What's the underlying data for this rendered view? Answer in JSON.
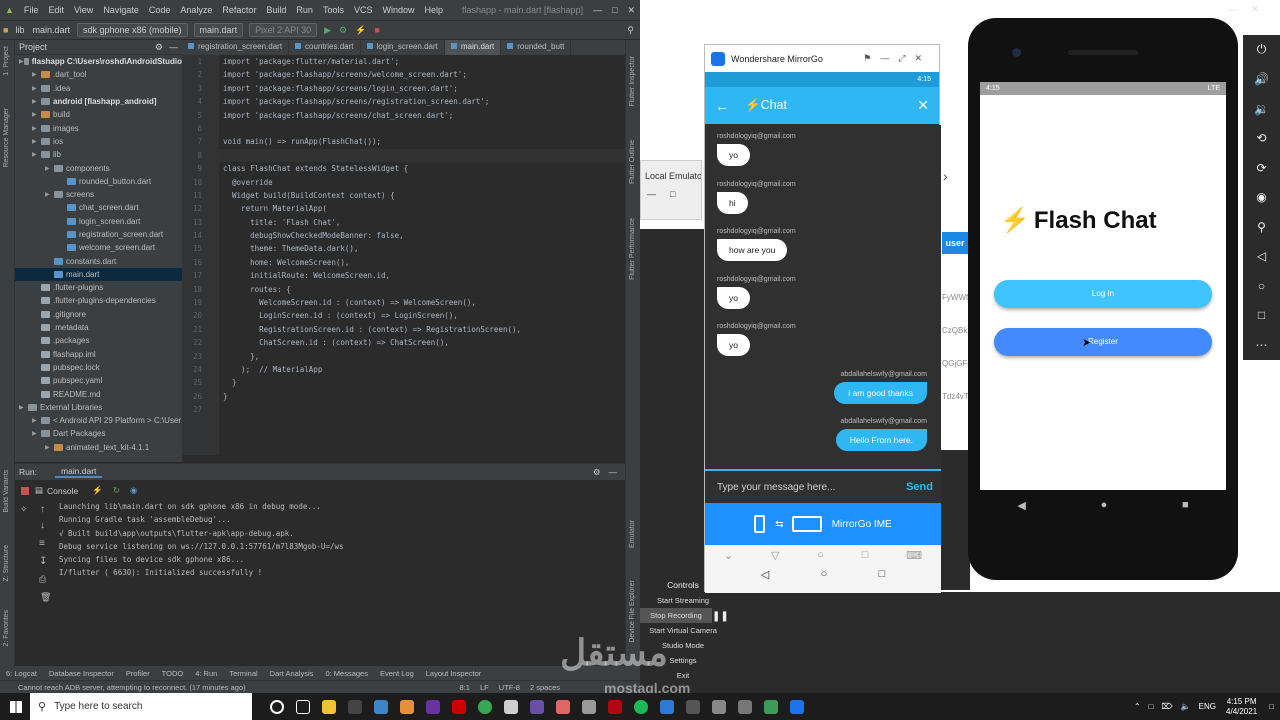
{
  "ide": {
    "menu": [
      "File",
      "Edit",
      "View",
      "Navigate",
      "Code",
      "Analyze",
      "Refactor",
      "Build",
      "Run",
      "Tools",
      "VCS",
      "Window",
      "Help"
    ],
    "window_title": "flashapp - main.dart [flashapp]",
    "toolbar": {
      "crumb_lib": "lib",
      "crumb_file": "main.dart",
      "device": "sdk gphone x86 (mobile)",
      "run_config": "main.dart",
      "avd": "Pixel 2 API 30"
    },
    "project_label": "Project",
    "tree": [
      {
        "label": "flashapp  C:\\Users\\roshd\\AndroidStudio",
        "indent": 0,
        "icon": "fold",
        "bold": true
      },
      {
        "label": ".dart_tool",
        "indent": 1,
        "icon": "fold-o"
      },
      {
        "label": ".idea",
        "indent": 1,
        "icon": "fold"
      },
      {
        "label": "android [flashapp_android]",
        "indent": 1,
        "icon": "fold",
        "bold": true
      },
      {
        "label": "build",
        "indent": 1,
        "icon": "fold-o"
      },
      {
        "label": "images",
        "indent": 1,
        "icon": "fold"
      },
      {
        "label": "ios",
        "indent": 1,
        "icon": "fold"
      },
      {
        "label": "lib",
        "indent": 1,
        "icon": "fold"
      },
      {
        "label": "components",
        "indent": 2,
        "icon": "fold"
      },
      {
        "label": "rounded_button.dart",
        "indent": 3,
        "icon": "fl"
      },
      {
        "label": "screens",
        "indent": 2,
        "icon": "fold"
      },
      {
        "label": "chat_screen.dart",
        "indent": 3,
        "icon": "fl"
      },
      {
        "label": "login_screen.dart",
        "indent": 3,
        "icon": "fl"
      },
      {
        "label": "registration_screen.dart",
        "indent": 3,
        "icon": "fl"
      },
      {
        "label": "welcome_screen.dart",
        "indent": 3,
        "icon": "fl"
      },
      {
        "label": "constants.dart",
        "indent": 2,
        "icon": "fl"
      },
      {
        "label": "main.dart",
        "indent": 2,
        "icon": "fl",
        "sel": true
      },
      {
        "label": ".flutter-plugins",
        "indent": 1,
        "icon": "fy"
      },
      {
        "label": ".flutter-plugins-dependencies",
        "indent": 1,
        "icon": "fy"
      },
      {
        "label": ".gitignore",
        "indent": 1,
        "icon": "fy"
      },
      {
        "label": ".metadata",
        "indent": 1,
        "icon": "fy"
      },
      {
        "label": ".packages",
        "indent": 1,
        "icon": "fy"
      },
      {
        "label": "flashapp.iml",
        "indent": 1,
        "icon": "fy"
      },
      {
        "label": "pubspec.lock",
        "indent": 1,
        "icon": "fy"
      },
      {
        "label": "pubspec.yaml",
        "indent": 1,
        "icon": "fy"
      },
      {
        "label": "README.md",
        "indent": 1,
        "icon": "fy"
      },
      {
        "label": "External Libraries",
        "indent": 0,
        "icon": "fold"
      },
      {
        "label": "< Android API 29 Platform >  C:\\User",
        "indent": 1,
        "icon": "fold"
      },
      {
        "label": "Dart Packages",
        "indent": 1,
        "icon": "fold"
      },
      {
        "label": "animated_text_kit-4.1.1",
        "indent": 2,
        "icon": "fold-o"
      }
    ],
    "tabs": [
      "registration_screen.dart",
      "countries.dart",
      "login_screen.dart",
      "main.dart",
      "rounded_butt"
    ],
    "active_tab": 3,
    "line_numbers": [
      "1",
      "2",
      "3",
      "4",
      "5",
      "6",
      "7",
      "8",
      "9",
      "10",
      "11",
      "12",
      "13",
      "14",
      "15",
      "16",
      "17",
      "18",
      "19",
      "20",
      "21",
      "22",
      "23",
      "24",
      "25",
      "26",
      "27"
    ],
    "code": [
      "import 'package:flutter/material.dart';",
      "import 'package:flashapp/screens/welcome_screen.dart';",
      "import 'package:flashapp/screens/login_screen.dart';",
      "import 'package:flashapp/screens/registration_screen.dart';",
      "import 'package:flashapp/screens/chat_screen.dart';",
      "",
      "void main() => runApp(FlashChat());",
      "",
      "class FlashChat extends StatelessWidget {",
      "  @override",
      "  Widget build(BuildContext context) {",
      "    return MaterialApp(",
      "      title: 'Flash Chat',",
      "      debugShowCheckedModeBanner: false,",
      "      theme: ThemeData.dark(),",
      "      home: WelcomeScreen(),",
      "      initialRoute: WelcomeScreen.id,",
      "      routes: {",
      "        WelcomeScreen.id : (context) => WelcomeScreen(),",
      "        LoginScreen.id : (context) => LoginScreen(),",
      "        RegistrationScreen.id : (context) => RegistrationScreen(),",
      "        ChatScreen.id : (context) => ChatScreen(),",
      "      },",
      "    );  // MaterialApp",
      "  }",
      "}",
      ""
    ],
    "run_label": "Run:",
    "run_tab": "main.dart",
    "console_label": "Console",
    "console": [
      "Launching lib\\main.dart on sdk gphone x86 in debug mode...",
      "Running Gradle task 'assembleDebug'...",
      "√ Built build\\app\\outputs\\flutter-apk\\app-debug.apk.",
      "Debug service listening on ws://127.0.0.1:57761/m7l83Mgob-U=/ws",
      "Syncing files to device sdk gphone x86...",
      "I/flutter ( 6630): Initialized successfully !"
    ],
    "bottom_tools": [
      "6: Logcat",
      "Database Inspector",
      "Profiler",
      "TODO",
      "4: Run",
      "Terminal",
      "Dart Analysis",
      "0: Messages",
      "Event Log",
      "Layout Inspector"
    ],
    "status": "Cannot reach ADB server, attempting to reconnect. (17 minutes ago)",
    "status_right": [
      "8:1",
      "LF",
      "UTF-8",
      "2 spaces"
    ],
    "left_strip": [
      "1: Project",
      "Resource Manager",
      "Build Variants",
      "Z: Structure",
      "2: Favorites"
    ],
    "right_strip": [
      "Flutter Inspector",
      "Flutter Outline",
      "Flutter Performance",
      "Emulator",
      "Device File Explorer"
    ]
  },
  "middle": {
    "emu_label": "Local Emulato",
    "user_chip": "user",
    "codes": [
      "FyWWf",
      "CzQBk",
      "QGjGFe",
      "Tdz4vT"
    ],
    "controls_title": "Controls",
    "controls": [
      "Start Streaming",
      "Stop Recording",
      "Start Virtual Camera",
      "Studio Mode",
      "Settings",
      "Exit"
    ]
  },
  "mirrorgo": {
    "window_title": "Wondershare MirrorGo",
    "status_time": "4:15",
    "chat_title": "⚡Chat",
    "messages": [
      {
        "sender": "roshdologyiq@gmail.com",
        "text": "yo",
        "me": false
      },
      {
        "sender": "roshdologyiq@gmail.com",
        "text": "hi",
        "me": false
      },
      {
        "sender": "roshdologyiq@gmail.com",
        "text": "how are you",
        "me": false
      },
      {
        "sender": "roshdologyiq@gmail.com",
        "text": "yo",
        "me": false
      },
      {
        "sender": "roshdologyiq@gmail.com",
        "text": "yo",
        "me": false
      },
      {
        "sender": "abdallahelswify@gmail.com",
        "text": "i am good thanks",
        "me": true
      },
      {
        "sender": "abdallahelswify@gmail.com",
        "text": "Hello From here.",
        "me": true
      }
    ],
    "input_placeholder": "Type your message here...",
    "send_label": "Send",
    "ime_label": "MirrorGo IME"
  },
  "emulator": {
    "status_time": "4:15",
    "status_right": "LTE",
    "app_title": "Flash Chat",
    "bolt": "⚡",
    "login_label": "Log In",
    "register_label": "Register",
    "colors": {
      "login": "#40c4ff",
      "register": "#448aff"
    }
  },
  "taskbar": {
    "search_placeholder": "Type here to search",
    "lang": "ENG",
    "time": "4:15 PM",
    "date": "4/4/2021"
  },
  "watermark": {
    "arabic": "مستقل",
    "latin": "mostaql.com"
  }
}
